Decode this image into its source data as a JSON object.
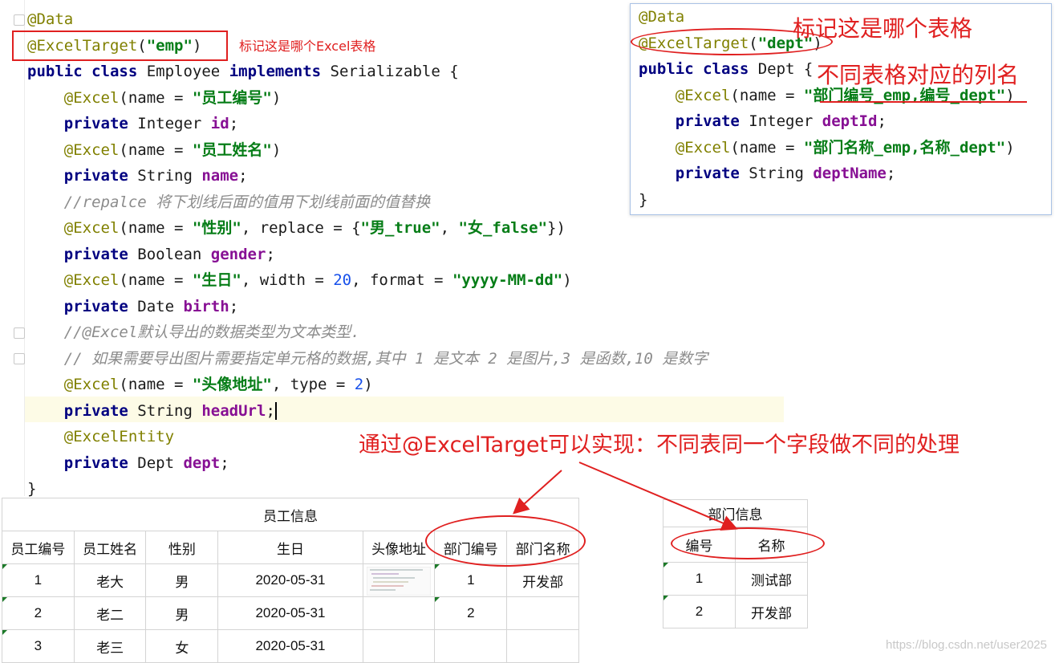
{
  "editor": {
    "lines": [
      [
        {
          "t": "@Data",
          "c": "ann"
        }
      ],
      [
        {
          "t": "@ExcelTarget",
          "c": "ann"
        },
        {
          "t": "("
        },
        {
          "t": "\"emp\"",
          "c": "str"
        },
        {
          "t": ")"
        }
      ],
      [
        {
          "t": "public",
          "c": "kw"
        },
        {
          "t": " "
        },
        {
          "t": "class",
          "c": "kw"
        },
        {
          "t": " Employee "
        },
        {
          "t": "implements",
          "c": "kw"
        },
        {
          "t": " Serializable {"
        }
      ],
      [
        {
          "t": "    "
        },
        {
          "t": "@Excel",
          "c": "ann"
        },
        {
          "t": "(name = "
        },
        {
          "t": "\"员工编号\"",
          "c": "str"
        },
        {
          "t": ")"
        }
      ],
      [
        {
          "t": "    "
        },
        {
          "t": "private",
          "c": "kw"
        },
        {
          "t": " Integer "
        },
        {
          "t": "id",
          "c": "fld"
        },
        {
          "t": ";"
        }
      ],
      [
        {
          "t": "    "
        },
        {
          "t": "@Excel",
          "c": "ann"
        },
        {
          "t": "(name = "
        },
        {
          "t": "\"员工姓名\"",
          "c": "str"
        },
        {
          "t": ")"
        }
      ],
      [
        {
          "t": "    "
        },
        {
          "t": "private",
          "c": "kw"
        },
        {
          "t": " String "
        },
        {
          "t": "name",
          "c": "fld"
        },
        {
          "t": ";"
        }
      ],
      [
        {
          "t": "    "
        },
        {
          "t": "//repalce 将下划线后面的值用下划线前面的值替换",
          "c": "cmt"
        }
      ],
      [
        {
          "t": "    "
        },
        {
          "t": "@Excel",
          "c": "ann"
        },
        {
          "t": "(name = "
        },
        {
          "t": "\"性别\"",
          "c": "str"
        },
        {
          "t": ", replace = {"
        },
        {
          "t": "\"男_true\"",
          "c": "str"
        },
        {
          "t": ", "
        },
        {
          "t": "\"女_false\"",
          "c": "str"
        },
        {
          "t": "})"
        }
      ],
      [
        {
          "t": "    "
        },
        {
          "t": "private",
          "c": "kw"
        },
        {
          "t": " Boolean "
        },
        {
          "t": "gender",
          "c": "fld"
        },
        {
          "t": ";"
        }
      ],
      [
        {
          "t": "    "
        },
        {
          "t": "@Excel",
          "c": "ann"
        },
        {
          "t": "(name = "
        },
        {
          "t": "\"生日\"",
          "c": "str"
        },
        {
          "t": ", width = "
        },
        {
          "t": "20",
          "c": "num"
        },
        {
          "t": ", format = "
        },
        {
          "t": "\"yyyy-MM-dd\"",
          "c": "str"
        },
        {
          "t": ")"
        }
      ],
      [
        {
          "t": "    "
        },
        {
          "t": "private",
          "c": "kw"
        },
        {
          "t": " Date "
        },
        {
          "t": "birth",
          "c": "fld"
        },
        {
          "t": ";"
        }
      ],
      [
        {
          "t": "    "
        },
        {
          "t": "//@Excel默认导出的数据类型为文本类型.",
          "c": "cmt"
        }
      ],
      [
        {
          "t": "    "
        },
        {
          "t": "// 如果需要导出图片需要指定单元格的数据,其中 1 是文本 2 是图片,3 是函数,10 是数字",
          "c": "cmt"
        }
      ],
      [
        {
          "t": "    "
        },
        {
          "t": "@Excel",
          "c": "ann"
        },
        {
          "t": "(name = "
        },
        {
          "t": "\"头像地址\"",
          "c": "str"
        },
        {
          "t": ", type = "
        },
        {
          "t": "2",
          "c": "num"
        },
        {
          "t": ")"
        }
      ],
      [
        {
          "t": "    "
        },
        {
          "t": "private",
          "c": "kw"
        },
        {
          "t": " String "
        },
        {
          "t": "headUrl",
          "c": "fld"
        },
        {
          "t": ";"
        }
      ],
      [
        {
          "t": "    "
        },
        {
          "t": "@ExcelEntity",
          "c": "ann"
        }
      ],
      [
        {
          "t": "    "
        },
        {
          "t": "private",
          "c": "kw"
        },
        {
          "t": " Dept "
        },
        {
          "t": "dept",
          "c": "fld"
        },
        {
          "t": ";"
        }
      ],
      [
        {
          "t": "}"
        }
      ]
    ]
  },
  "popup": {
    "lines": [
      [
        {
          "t": "@Data",
          "c": "ann"
        }
      ],
      [
        {
          "t": "@ExcelTarget",
          "c": "ann"
        },
        {
          "t": "("
        },
        {
          "t": "\"dept\"",
          "c": "str"
        },
        {
          "t": ")"
        }
      ],
      [
        {
          "t": "public",
          "c": "kw"
        },
        {
          "t": " "
        },
        {
          "t": "class",
          "c": "kw"
        },
        {
          "t": " Dept {"
        }
      ],
      [
        {
          "t": "    "
        },
        {
          "t": "@Excel",
          "c": "ann"
        },
        {
          "t": "(name = "
        },
        {
          "t": "\"部门编号_emp,编号_dept\"",
          "c": "str"
        },
        {
          "t": ")"
        }
      ],
      [
        {
          "t": "    "
        },
        {
          "t": "private",
          "c": "kw"
        },
        {
          "t": " Integer "
        },
        {
          "t": "deptId",
          "c": "fld"
        },
        {
          "t": ";"
        }
      ],
      [
        {
          "t": "    "
        },
        {
          "t": "@Excel",
          "c": "ann"
        },
        {
          "t": "(name = "
        },
        {
          "t": "\"部门名称_emp,名称_dept\"",
          "c": "str"
        },
        {
          "t": ")"
        }
      ],
      [
        {
          "t": "    "
        },
        {
          "t": "private",
          "c": "kw"
        },
        {
          "t": " String "
        },
        {
          "t": "deptName",
          "c": "fld"
        },
        {
          "t": ";"
        }
      ],
      [
        {
          "t": "}"
        }
      ]
    ]
  },
  "annotations": {
    "emp_note": "标记这是哪个Excel表格",
    "dept_note": "标记这是哪个表格",
    "column_note": "不同表格对应的列名",
    "main_note": "通过@ExcelTarget可以实现：不同表同一个字段做不同的处理"
  },
  "employee_sheet": {
    "title": "员工信息",
    "headers": [
      "员工编号",
      "员工姓名",
      "性别",
      "生日",
      "头像地址",
      "部门编号",
      "部门名称"
    ],
    "rows": [
      [
        "1",
        "老大",
        "男",
        "2020-05-31",
        "",
        "1",
        "开发部"
      ],
      [
        "2",
        "老二",
        "男",
        "2020-05-31",
        "",
        "2",
        ""
      ],
      [
        "3",
        "老三",
        "女",
        "2020-05-31",
        "",
        "",
        ""
      ]
    ]
  },
  "dept_sheet": {
    "title": "部门信息",
    "headers": [
      "编号",
      "名称"
    ],
    "rows": [
      [
        "1",
        "测试部"
      ],
      [
        "2",
        "开发部"
      ]
    ]
  },
  "watermark": "https://blog.csdn.net/user2025",
  "colors": {
    "annotation_red": "#e02020",
    "annotation_code": "#808000",
    "keyword": "#000080",
    "string": "#067d17",
    "field": "#871094",
    "number": "#1750eb",
    "comment": "#8c8c8c",
    "current_line": "#fdfbe6"
  }
}
